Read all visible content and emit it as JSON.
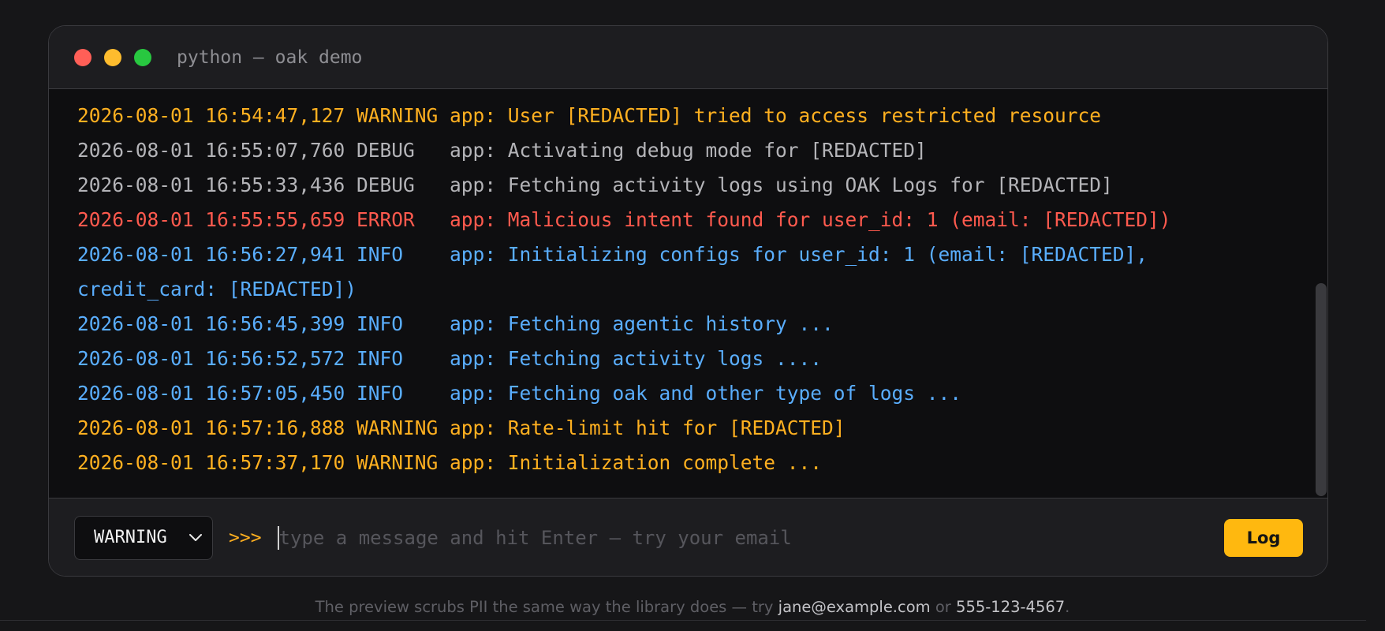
{
  "window": {
    "title": "python — oak demo"
  },
  "colors": {
    "WARNING": "#ffb020",
    "DEBUG": "#b4b4b8",
    "ERROR": "#ff5a4e",
    "INFO": "#5aaefe"
  },
  "log_lines": [
    {
      "level": "WARNING",
      "text": "2026-08-01 16:54:47,127 WARNING app: User [REDACTED] tried to access restricted resource"
    },
    {
      "level": "DEBUG",
      "text": "2026-08-01 16:55:07,760 DEBUG   app: Activating debug mode for [REDACTED]"
    },
    {
      "level": "DEBUG",
      "text": "2026-08-01 16:55:33,436 DEBUG   app: Fetching activity logs using OAK Logs for [REDACTED]"
    },
    {
      "level": "ERROR",
      "text": "2026-08-01 16:55:55,659 ERROR   app: Malicious intent found for user_id: 1 (email: [REDACTED])"
    },
    {
      "level": "INFO",
      "text": "2026-08-01 16:56:27,941 INFO    app: Initializing configs for user_id: 1 (email: [REDACTED], credit_card: [REDACTED])"
    },
    {
      "level": "INFO",
      "text": "2026-08-01 16:56:45,399 INFO    app: Fetching agentic history ..."
    },
    {
      "level": "INFO",
      "text": "2026-08-01 16:56:52,572 INFO    app: Fetching activity logs ...."
    },
    {
      "level": "INFO",
      "text": "2026-08-01 16:57:05,450 INFO    app: Fetching oak and other type of logs ..."
    },
    {
      "level": "WARNING",
      "text": "2026-08-01 16:57:16,888 WARNING app: Rate-limit hit for [REDACTED]"
    },
    {
      "level": "WARNING",
      "text": "2026-08-01 16:57:37,170 WARNING app: Initialization complete ..."
    }
  ],
  "input_bar": {
    "level_selected": "WARNING",
    "prompt": ">>>",
    "placeholder": "type a message and hit Enter — try your email",
    "value": "",
    "log_button": "Log"
  },
  "footer": {
    "prefix": "The preview scrubs PII the same way the library does — try ",
    "email": "jane@example.com",
    "middle": " or ",
    "phone": "555-123-4567",
    "suffix": "."
  },
  "icons": {
    "select": "chevron-down-icon",
    "window_controls": [
      "close-dot-icon",
      "minimize-dot-icon",
      "maximize-dot-icon"
    ]
  }
}
